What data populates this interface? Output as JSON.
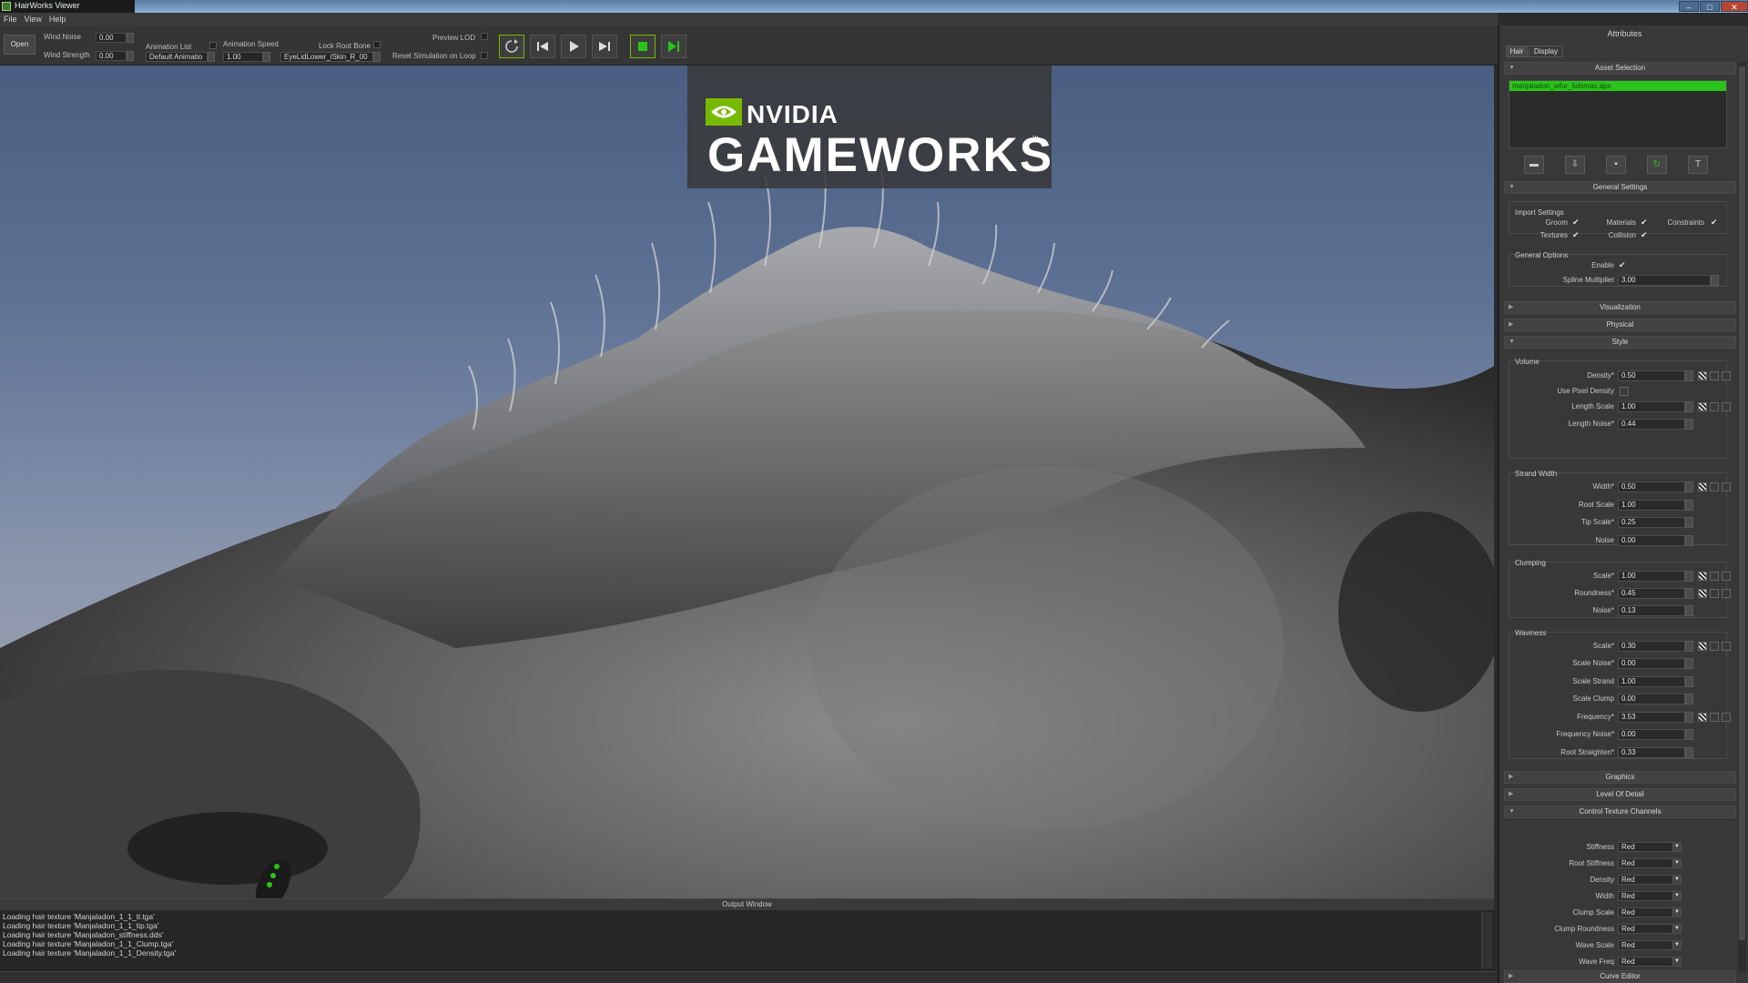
{
  "window": {
    "title": "HairWorks Viewer",
    "controls": [
      "–",
      "□",
      "✕"
    ]
  },
  "menu": [
    "File",
    "View",
    "Help"
  ],
  "toolbar": {
    "open_label": "Open",
    "wind_noise_label": "Wind Noise",
    "wind_noise_value": "0.00",
    "wind_strength_label": "Wind Strength",
    "wind_strength_value": "0.00",
    "animation_list_label": "Animation List",
    "animation_list_value": "Default Animatio",
    "animation_speed_label": "Animation Speed",
    "animation_speed_value": "1.00",
    "lock_root_bone_label": "Lock Root Bone",
    "lock_root_bone_value": "EyeLidLower_iSkin_R_00",
    "preview_lod_label": "Preview LOD",
    "reset_sim_label": "Reset Simulation on Loop"
  },
  "logo": {
    "brand": "NVIDIA",
    "product": "GAMEWORKS",
    "tm": "™"
  },
  "output": {
    "title": "Output Window",
    "lines": [
      "Loading hair texture 'Manjaladon_1_1_tl.tga'",
      "Loading hair texture 'Manjaladon_1_1_tip.tga'",
      "Loading hair texture 'Manjaladon_stiffness.dds'",
      "Loading hair texture 'Manjaladon_1_1_Clump.tga'",
      "Loading hair texture 'Manjaladon_1_1_Density.tga'"
    ]
  },
  "panel": {
    "title": "Attributes",
    "tabs": [
      "Hair",
      "Display"
    ],
    "asset_selection": {
      "header": "Asset Selection",
      "item": "manjaladon_wfur_5dsmax.apx"
    },
    "general_settings": {
      "header": "General Settings",
      "import_settings_label": "Import Settings",
      "groom": "Groom",
      "materials": "Materials",
      "constraints": "Constraints",
      "textures": "Textures",
      "collision": "Collision",
      "general_options_label": "General Options",
      "enable": "Enable",
      "spline_multiplier": "Spline Multiplier",
      "spline_multiplier_value": "3.00"
    },
    "visualization": "Visualization",
    "physical": "Physical",
    "style": {
      "header": "Style",
      "volume": "Volume",
      "density": "Density*",
      "density_value": "0.50",
      "use_pixel_density": "Use Pixel Density",
      "length_scale": "Length Scale",
      "length_scale_value": "1.00",
      "length_noise": "Length Noise*",
      "length_noise_value": "0.44",
      "strand_width": "Strand Width",
      "width": "Width*",
      "width_value": "0.50",
      "root_scale": "Root Scale",
      "root_scale_value": "1.00",
      "tip_scale": "Tip Scale*",
      "tip_scale_value": "0.25",
      "sw_noise": "Noise",
      "sw_noise_value": "0.00",
      "clumping": "Clumping",
      "clump_scale": "Scale*",
      "clump_scale_value": "1.00",
      "roundness": "Roundness*",
      "roundness_value": "0.45",
      "clump_noise": "Noise*",
      "clump_noise_value": "0.13",
      "waviness": "Waviness",
      "wave_scale": "Scale*",
      "wave_scale_value": "0.30",
      "scale_noise": "Scale Noise*",
      "scale_noise_value": "0.00",
      "scale_strand": "Scale Strand",
      "scale_strand_value": "1.00",
      "scale_clump": "Scale Clump",
      "scale_clump_value": "0.00",
      "frequency": "Frequency*",
      "frequency_value": "3.53",
      "frequency_noise": "Frequency Noise*",
      "frequency_noise_value": "0.00",
      "root_straighten": "Root Straighten*",
      "root_straighten_value": "0.33"
    },
    "graphics": "Graphics",
    "level_of_detail": "Level Of Detail",
    "control_texture": {
      "header": "Control Texture Channels",
      "rows": [
        {
          "label": "Stiffness",
          "value": "Red"
        },
        {
          "label": "Root Stiffness",
          "value": "Red"
        },
        {
          "label": "Density",
          "value": "Red"
        },
        {
          "label": "Width",
          "value": "Red"
        },
        {
          "label": "Clump Scale",
          "value": "Red"
        },
        {
          "label": "Clump Roundness",
          "value": "Red"
        },
        {
          "label": "Wave Scale",
          "value": "Red"
        },
        {
          "label": "Wave Freq",
          "value": "Red"
        }
      ]
    },
    "curve_editor": "Curve Editor"
  },
  "colors": {
    "accent_green": "#29c419",
    "nvidia_green": "#76b900"
  }
}
